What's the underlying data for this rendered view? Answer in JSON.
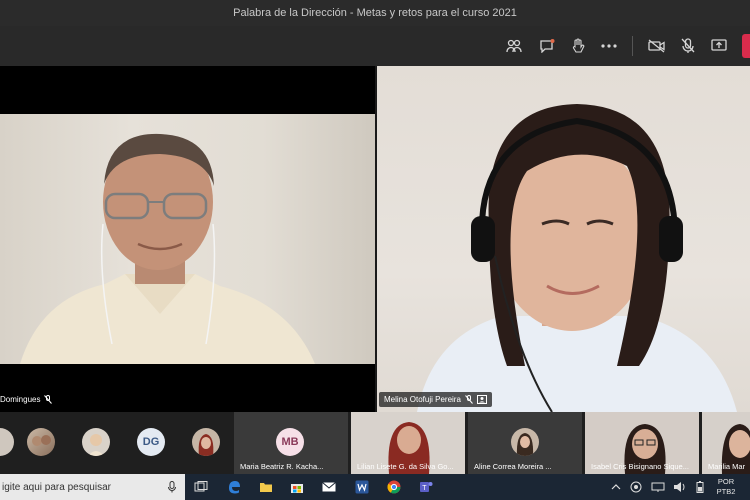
{
  "window": {
    "title": "Palabra de la Dirección - Metas y retos para el curso 2021"
  },
  "stage": {
    "left_participant": {
      "name": "Domingues"
    },
    "right_participant": {
      "name": "Melina Otofuji Pereira"
    }
  },
  "strip": {
    "avatars": [
      {
        "type": "photo"
      },
      {
        "type": "photo"
      },
      {
        "type": "initials",
        "initials": "DG"
      },
      {
        "type": "photo"
      }
    ],
    "tiles": [
      {
        "initials": "MB",
        "name": "Maria Beatriz R. Kacha..."
      },
      {
        "name": "Lilian Lisete G. da Silva Go..."
      },
      {
        "name": "Aline Correa Moreira ..."
      },
      {
        "name": "Isabel Cris Bisignano Sique..."
      },
      {
        "name": "Marilia Mar"
      }
    ]
  },
  "taskbar": {
    "search_placeholder": "igite aqui para pesquisar",
    "lang": "POR",
    "layout": "PTB2"
  },
  "colors": {
    "leave": "#d92c4c",
    "titlebar": "#2b2b2b",
    "toolbar": "#292929",
    "taskbar": "#1b2634"
  }
}
